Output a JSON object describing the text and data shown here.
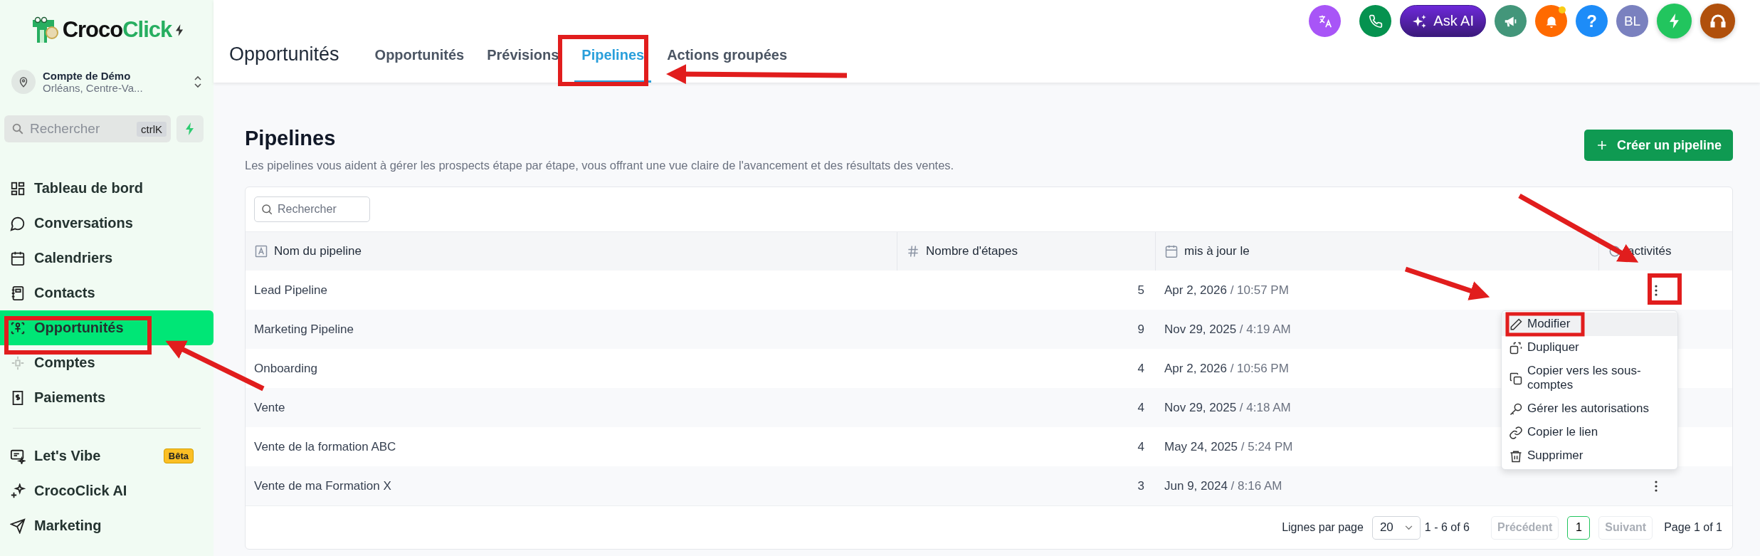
{
  "brand": {
    "name_start": "Croco",
    "name_end": "Click"
  },
  "account": {
    "name": "Compte de Démo",
    "location": "Orléans, Centre-Va..."
  },
  "sidebar_search": {
    "placeholder": "Rechercher",
    "shortcut": "ctrlK"
  },
  "nav_main": [
    {
      "label": "Tableau de bord",
      "kind": "grid",
      "selected": false
    },
    {
      "label": "Conversations",
      "kind": "chat",
      "selected": false
    },
    {
      "label": "Calendriers",
      "kind": "calendar",
      "selected": false
    },
    {
      "label": "Contacts",
      "kind": "book",
      "selected": false
    },
    {
      "label": "Opportunités",
      "kind": "network",
      "selected": true
    },
    {
      "label": "Comptes",
      "kind": "accounts",
      "selected": false
    },
    {
      "label": "Paiements",
      "kind": "receipt",
      "selected": false
    }
  ],
  "nav_secondary": [
    {
      "label": "Let's Vibe",
      "kind": "vibe",
      "selected": false,
      "badge": "Bêta"
    },
    {
      "label": "CrocoClick AI",
      "kind": "sparkle",
      "selected": false
    },
    {
      "label": "Marketing",
      "kind": "send",
      "selected": false
    }
  ],
  "header": {
    "title": "Opportunités",
    "tabs": [
      {
        "label": "Opportunités",
        "selected": false
      },
      {
        "label": "Prévisions",
        "selected": false
      },
      {
        "label": "Pipelines",
        "selected": true
      },
      {
        "label": "Actions groupées",
        "selected": false
      }
    ]
  },
  "toolbar": {
    "ask_ai": "Ask AI",
    "help": "?",
    "avatar": "BL",
    "notification_dot": true
  },
  "page": {
    "title": "Pipelines",
    "description": "Les pipelines vous aident à gérer les prospects étape par étape, vous offrant une vue claire de l'avancement et des résultats des ventes.",
    "create_button": "Créer un pipeline"
  },
  "table": {
    "search_placeholder": "Rechercher",
    "columns": [
      {
        "label": "Nom du pipeline",
        "kind": "text"
      },
      {
        "label": "Nombre d'étapes",
        "kind": "hash"
      },
      {
        "label": "mis à jour le",
        "kind": "calendar"
      },
      {
        "label": "activités",
        "kind": "activity"
      }
    ],
    "rows": [
      {
        "name": "Lead Pipeline",
        "stages": "5",
        "date": "Apr 2, 2026",
        "separator": "/",
        "time": "10:57 PM",
        "menu_button": true
      },
      {
        "name": "Marketing Pipeline",
        "stages": "9",
        "date": "Nov 29, 2025",
        "separator": "/",
        "time": "4:19 AM",
        "menu_button": false
      },
      {
        "name": "Onboarding",
        "stages": "4",
        "date": "Apr 2, 2026",
        "separator": "/",
        "time": "10:56 PM",
        "menu_button": false
      },
      {
        "name": "Vente",
        "stages": "4",
        "date": "Nov 29, 2025",
        "separator": "/",
        "time": "4:18 AM",
        "menu_button": false
      },
      {
        "name": "Vente de la formation ABC",
        "stages": "4",
        "date": "May 24, 2025",
        "separator": "/",
        "time": "5:24 PM",
        "menu_button": false
      },
      {
        "name": "Vente de ma Formation X",
        "stages": "3",
        "date": "Jun 9, 2024",
        "separator": "/",
        "time": "8:16 AM",
        "menu_button": true
      }
    ]
  },
  "row_menu": {
    "items": [
      {
        "label": "Modifier",
        "kind": "pencil",
        "selected": true
      },
      {
        "label": "Dupliquer",
        "kind": "duplicate",
        "selected": false
      },
      {
        "label": "Copier vers les sous-comptes",
        "kind": "copy",
        "selected": false
      },
      {
        "label": "Gérer les autorisations",
        "kind": "key",
        "selected": false
      },
      {
        "label": "Copier le lien",
        "kind": "link",
        "selected": false
      },
      {
        "label": "Supprimer",
        "kind": "trash",
        "selected": false
      }
    ]
  },
  "pagination": {
    "rows_label": "Lignes par page",
    "page_size": "20",
    "range": "1 - 6 of 6",
    "previous": "Précédent",
    "previous_disabled": true,
    "current_page": "1",
    "next": "Suivant",
    "next_disabled": true,
    "page_info": "Page 1 of 1"
  }
}
